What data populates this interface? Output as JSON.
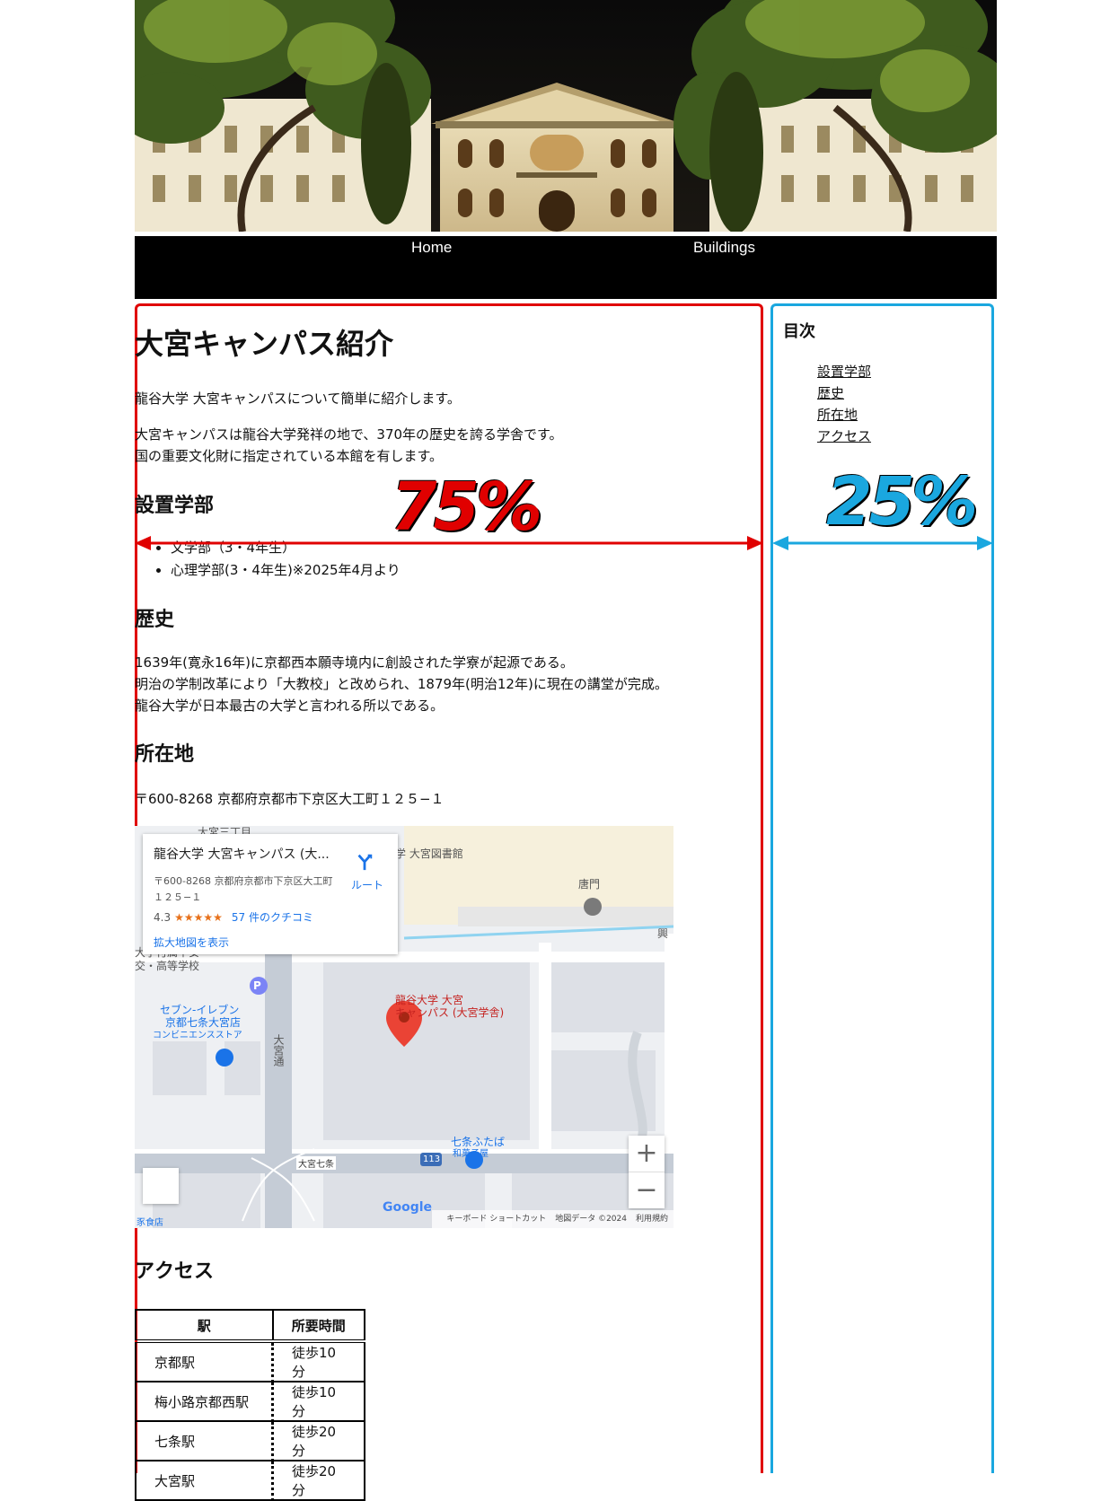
{
  "nav": {
    "home": "Home",
    "buildings": "Buildings"
  },
  "main": {
    "title": "大宮キャンパス紹介",
    "intro": "龍谷大学 大宮キャンパスについて簡単に紹介します。",
    "desc_line1": "大宮キャンパスは龍谷大学発祥の地で、370年の歴史を誇る学舎です。",
    "desc_line2": "国の重要文化財に指定されている本館を有します。",
    "faculties_heading": "設置学部",
    "faculties": [
      "文学部（3・4年生）",
      "心理学部(3・4年生)※2025年4月より"
    ],
    "history_heading": "歴史",
    "history_lines": [
      "1639年(寛永16年)に京都西本願寺境内に創設された学寮が起源である。",
      "明治の学制改革により「大教校」と改められ、1879年(明治12年)に現在の講堂が完成。",
      "龍谷大学が日本最古の大学と言われる所以である。"
    ],
    "location_heading": "所在地",
    "address": "〒600-8268 京都府京都市下京区大工町１２５−１",
    "access_heading": "アクセス"
  },
  "map": {
    "card_title": "龍谷大学 大宮キャンパス (大...",
    "card_address": "〒600-8268 京都府京都市下京区大工町１２５−１",
    "rating": "4.3",
    "stars": "★★★★★",
    "reviews": "57 件のクチコミ",
    "enlarge": "拡大地図を表示",
    "route": "ルート",
    "pin_label_1": "龍谷大学 大宮",
    "pin_label_2": "キャンパス (大宮学舎)",
    "labels": {
      "library": "学 大宮図書館",
      "karamon": "唐門",
      "seven_eleven_1": "セブン-イレブン",
      "seven_eleven_2": "京都七条大宮店",
      "seven_eleven_3": "コンビニエンスストア",
      "school_1": "大学付属平安",
      "school_2": "交・高等学校",
      "omiya_dori": "大宮通",
      "omiya_shichijo": "大宮七条",
      "route_113": "113",
      "shop_1": "七条ふたば",
      "shop_2": "和菓子屋",
      "top_street": "大宮三丁目",
      "bottom_left": "豕食店",
      "right_edge": "興"
    },
    "google": "Google",
    "footer_keyboard": "キーボード ショートカット",
    "footer_data": "地図データ ©2024",
    "footer_terms": "利用規約",
    "zoom_in": "+",
    "zoom_out": "−"
  },
  "access_table": {
    "headers": [
      "駅",
      "所要時間"
    ],
    "rows": [
      [
        "京都駅",
        "徒歩10分"
      ],
      [
        "梅小路京都西駅",
        "徒歩10分"
      ],
      [
        "七条駅",
        "徒歩20分"
      ],
      [
        "大宮駅",
        "徒歩20分"
      ]
    ]
  },
  "toc": {
    "title": "目次",
    "items": [
      "設置学部",
      "歴史",
      "所在地",
      "アクセス"
    ]
  },
  "annotations": {
    "main_pct": "75%",
    "side_pct": "25%",
    "main_color": "#e00000",
    "side_color": "#1aa7df"
  }
}
